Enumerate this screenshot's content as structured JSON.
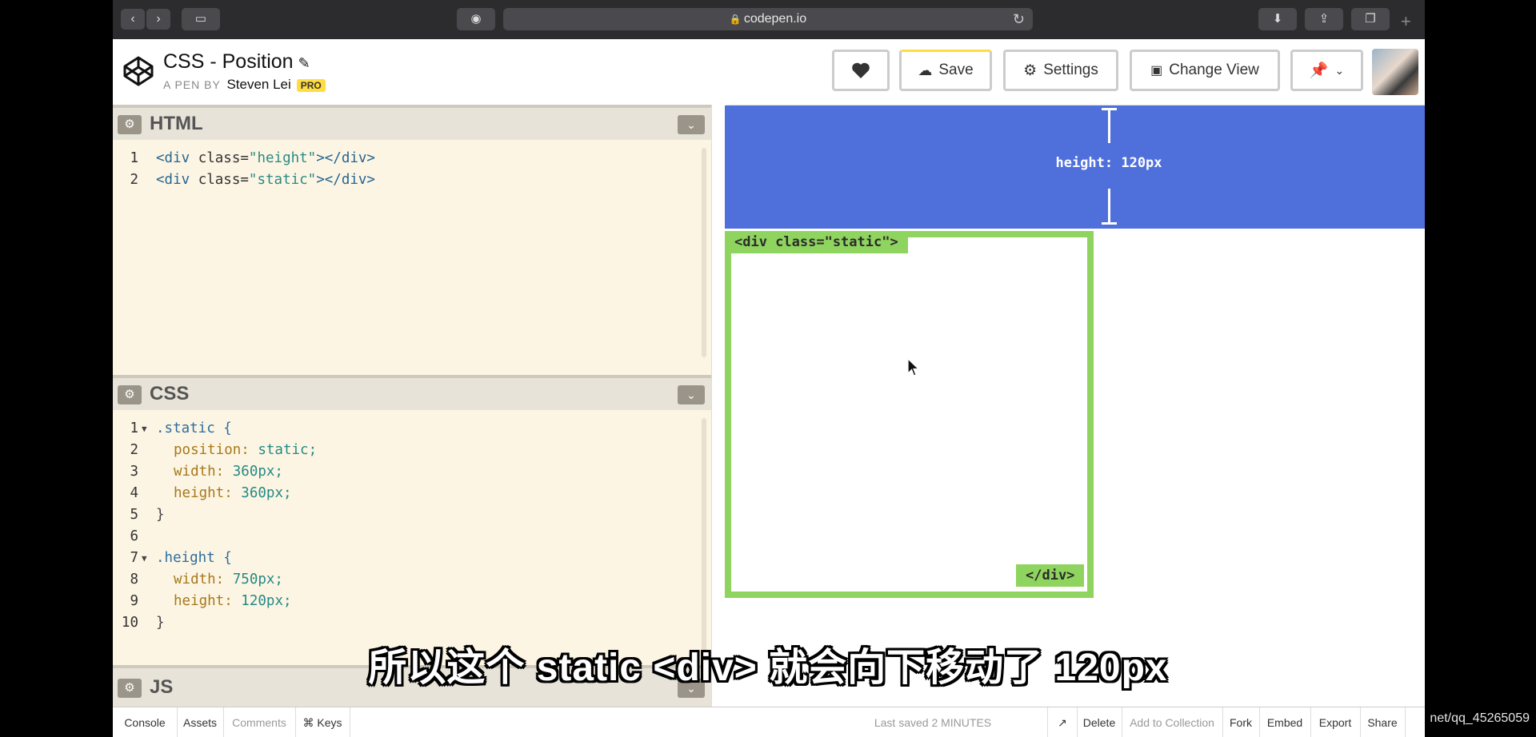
{
  "browser": {
    "url": "codepen.io",
    "icons": [
      "back-icon",
      "forward-icon",
      "sidebar-icon",
      "privacy-icon",
      "lock-icon",
      "reload-icon",
      "download-icon",
      "share-icon",
      "tabs-icon",
      "new-tab-icon"
    ]
  },
  "header": {
    "title": "CSS - Position",
    "byline_prefix": "A PEN BY",
    "author": "Steven Lei",
    "badge": "PRO",
    "buttons": {
      "save": "Save",
      "settings": "Settings",
      "change_view": "Change View"
    }
  },
  "editor": {
    "html": {
      "title": "HTML",
      "lines": [
        [
          "<div class=\"",
          "height",
          "\"></div>"
        ],
        [
          "<div class=\"",
          "static",
          "\"></div>"
        ]
      ]
    },
    "css": {
      "title": "CSS",
      "lines": [
        {
          "n": "1",
          "fold": true,
          "sel": ".static {"
        },
        {
          "n": "2",
          "prop": "position:",
          "val": " static;"
        },
        {
          "n": "3",
          "prop": "width:",
          "val": " 360px;"
        },
        {
          "n": "4",
          "prop": "height:",
          "val": " 360px;"
        },
        {
          "n": "5",
          "plain": "}"
        },
        {
          "n": "6",
          "plain": ""
        },
        {
          "n": "7",
          "fold": true,
          "sel": ".height {"
        },
        {
          "n": "8",
          "prop": "width:",
          "val": " 750px;"
        },
        {
          "n": "9",
          "prop": "height:",
          "val": " 120px;"
        },
        {
          "n": "10",
          "plain": "}"
        }
      ]
    },
    "js": {
      "title": "JS"
    }
  },
  "preview": {
    "height_label": "height: 120px",
    "open_tag": "<div class=\"static\">",
    "close_tag": "</div>",
    "colors": {
      "blue": "#4f6fdb",
      "green": "#8fd45f"
    }
  },
  "subtitle": "所以这个 static <div> 就会向下移动了 120px",
  "footer": {
    "console": "Console",
    "assets": "Assets",
    "comments": "Comments",
    "keys": "⌘ Keys",
    "last_saved": "Last saved 2 MINUTES ago",
    "delete": "Delete",
    "add_to_collection": "Add to Collection",
    "fork": "Fork",
    "embed": "Embed",
    "export": "Export",
    "share": "Share"
  },
  "watermark": "net/qq_45265059"
}
